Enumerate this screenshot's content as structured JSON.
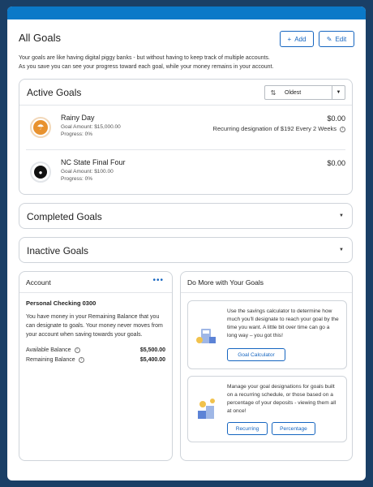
{
  "page": {
    "title": "All Goals",
    "add_label": "Add",
    "edit_label": "Edit",
    "intro_line1": "Your goals are like having digital piggy banks - but without having to keep track of multiple accounts.",
    "intro_line2": "As you save you can see your progress toward each goal, while your money remains in your account."
  },
  "active_goals": {
    "title": "Active Goals",
    "sort_selected": "Oldest",
    "goals": [
      {
        "name": "Rainy Day",
        "goal_amount": "Goal Amount: $15,000.00",
        "progress": "Progress: 0%",
        "amount": "$0.00",
        "recurring": "Recurring designation of $192 Every 2 Weeks",
        "icon": "umbrella-icon"
      },
      {
        "name": "NC State Final Four",
        "goal_amount": "Goal Amount: $100.00",
        "progress": "Progress: 0%",
        "amount": "$0.00",
        "icon": "basketball-icon"
      }
    ]
  },
  "completed_goals": {
    "title": "Completed Goals"
  },
  "inactive_goals": {
    "title": "Inactive Goals"
  },
  "account": {
    "title": "Account",
    "name": "Personal Checking 0300",
    "description": "You have money in your Remaining Balance that you can designate to goals. Your money never moves from your account when saving towards your goals.",
    "available_label": "Available Balance",
    "available_value": "$5,500.00",
    "remaining_label": "Remaining Balance",
    "remaining_value": "$5,400.00"
  },
  "do_more": {
    "title": "Do More with Your Goals",
    "calc_text": "Use the savings calculator to determine how much you'll designate to reach your goal by the time you want. A little bit over time can go a long way – you got this!",
    "calc_button": "Goal Calculator",
    "manage_text": "Manage your goal designations for goals built on a recurring schedule, or those based on a percentage of your deposits - viewing them all at once!",
    "recurring_button": "Recurring",
    "percentage_button": "Percentage"
  },
  "colors": {
    "accent": "#1565c0",
    "topbar": "#0b79c8",
    "frame_bg": "#1a3f66"
  }
}
